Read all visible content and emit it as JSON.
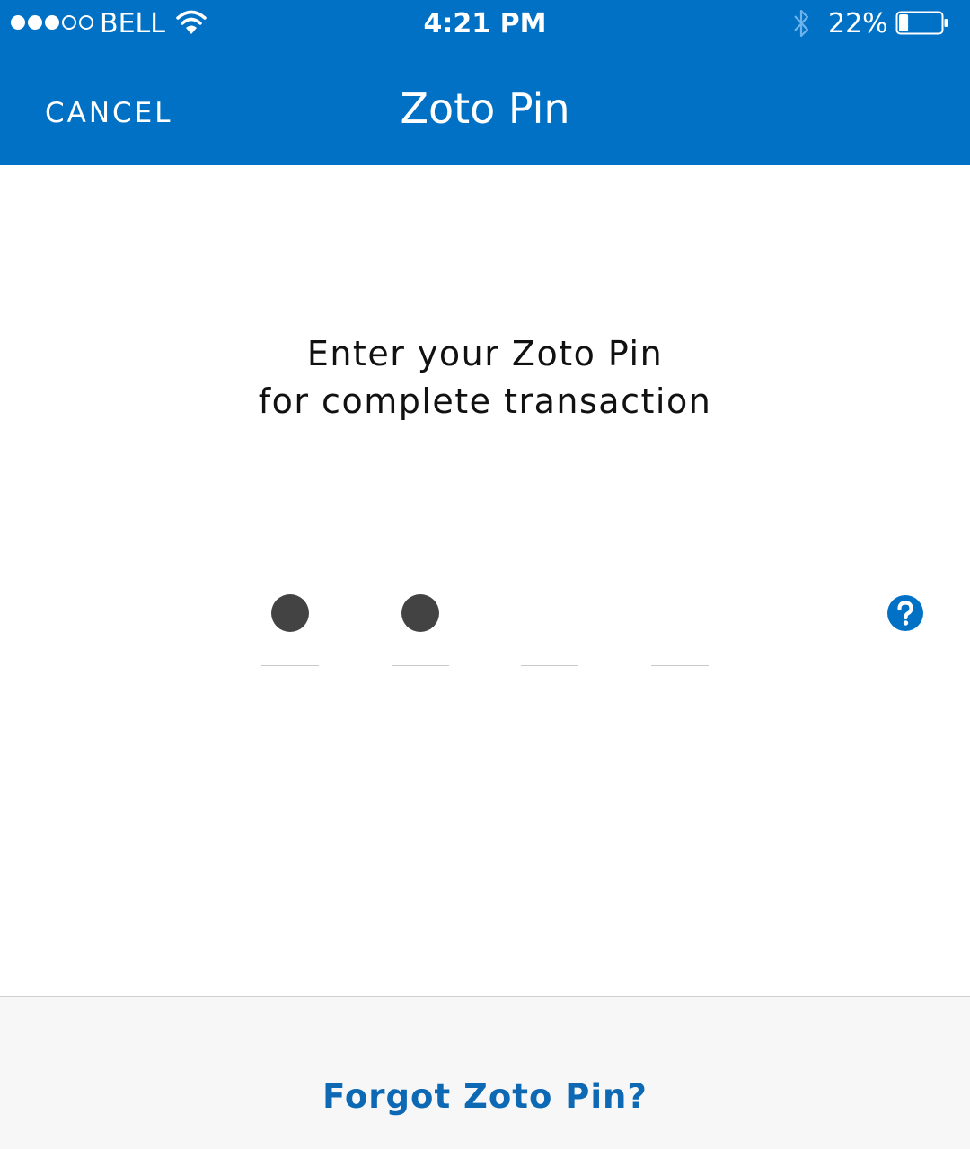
{
  "status_bar": {
    "signal_filled": 3,
    "signal_total": 5,
    "carrier": "BELL",
    "time": "4:21 PM",
    "battery_percent": "22%",
    "battery_level": 0.22,
    "icons": [
      "signal-dots",
      "wifi-icon",
      "bluetooth-icon",
      "battery-icon"
    ]
  },
  "nav": {
    "cancel_label": "CANCEL",
    "title": "Zoto Pin"
  },
  "prompt": {
    "line1": "Enter your Zoto Pin",
    "line2": "for complete transaction"
  },
  "pin": {
    "length": 4,
    "entered": 2
  },
  "help": {
    "icon": "help-icon"
  },
  "footer": {
    "forgot_label": "Forgot Zoto Pin?"
  },
  "colors": {
    "primary": "#0071c5",
    "link": "#0e69b4",
    "pin_dot": "#434343",
    "footer_bg": "#f7f7f7"
  }
}
